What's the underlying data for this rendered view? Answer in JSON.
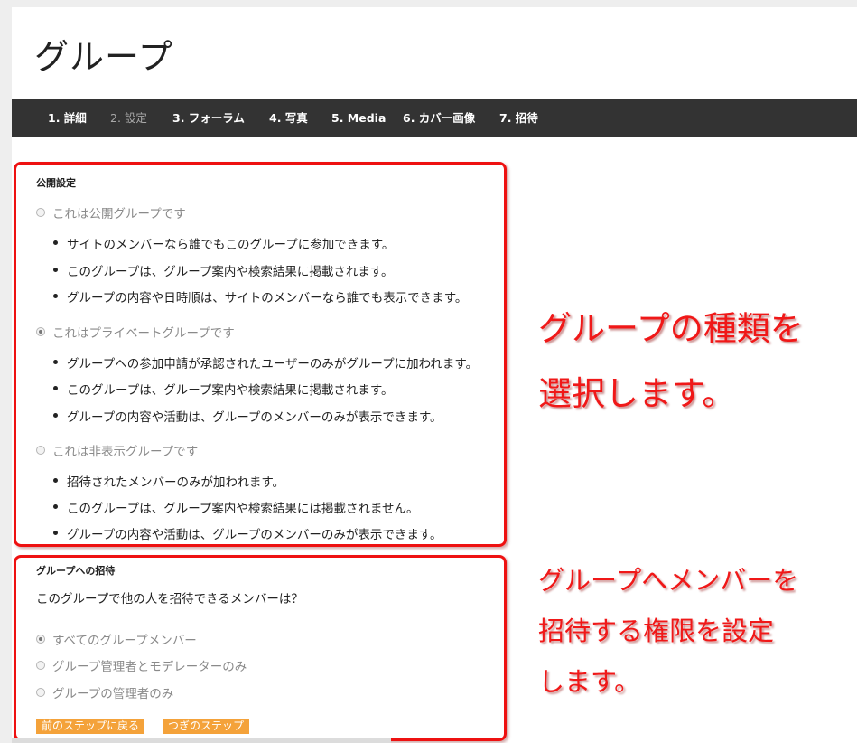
{
  "page_title": "グループ",
  "tabs": [
    {
      "label": "1. 詳細",
      "current": false
    },
    {
      "label": "2. 設定",
      "current": true
    },
    {
      "label": "3. フォーラム",
      "current": false
    },
    {
      "label": "4. 写真",
      "current": false
    },
    {
      "label": "5. Media",
      "current": false
    },
    {
      "label": "6. カバー画像",
      "current": false
    },
    {
      "label": "7. 招待",
      "current": false
    }
  ],
  "privacy": {
    "heading": "公開設定",
    "options": [
      {
        "label": "これは公開グループです",
        "checked": false,
        "bullets": [
          "サイトのメンバーなら誰でもこのグループに参加できます。",
          "このグループは、グループ案内や検索結果に掲載されます。",
          "グループの内容や日時順は、サイトのメンバーなら誰でも表示できます。"
        ]
      },
      {
        "label": "これはプライベートグループです",
        "checked": true,
        "bullets": [
          "グループへの参加申請が承認されたユーザーのみがグループに加われます。",
          "このグループは、グループ案内や検索結果に掲載されます。",
          "グループの内容や活動は、グループのメンバーのみが表示できます。"
        ]
      },
      {
        "label": "これは非表示グループです",
        "checked": false,
        "bullets": [
          "招待されたメンバーのみが加われます。",
          "このグループは、グループ案内や検索結果には掲載されません。",
          "グループの内容や活動は、グループのメンバーのみが表示できます。"
        ]
      }
    ]
  },
  "invites": {
    "heading": "グループへの招待",
    "question": "このグループで他の人を招待できるメンバーは？",
    "options": [
      {
        "label": "すべてのグループメンバー",
        "checked": true
      },
      {
        "label": "グループ管理者とモデレーターのみ",
        "checked": false
      },
      {
        "label": "グループの管理者のみ",
        "checked": false
      }
    ]
  },
  "buttons": {
    "prev": "前のステップに戻る",
    "next": "つぎのステップ"
  },
  "annotations": {
    "privacy_note": [
      "グループの種類を",
      "選択します。"
    ],
    "invite_note": [
      "グループへメンバーを",
      "招待する権限を設定",
      "します。"
    ]
  },
  "colors": {
    "tabbar": "#333333",
    "button": "#f4a23a",
    "annotation": "#f01818"
  }
}
